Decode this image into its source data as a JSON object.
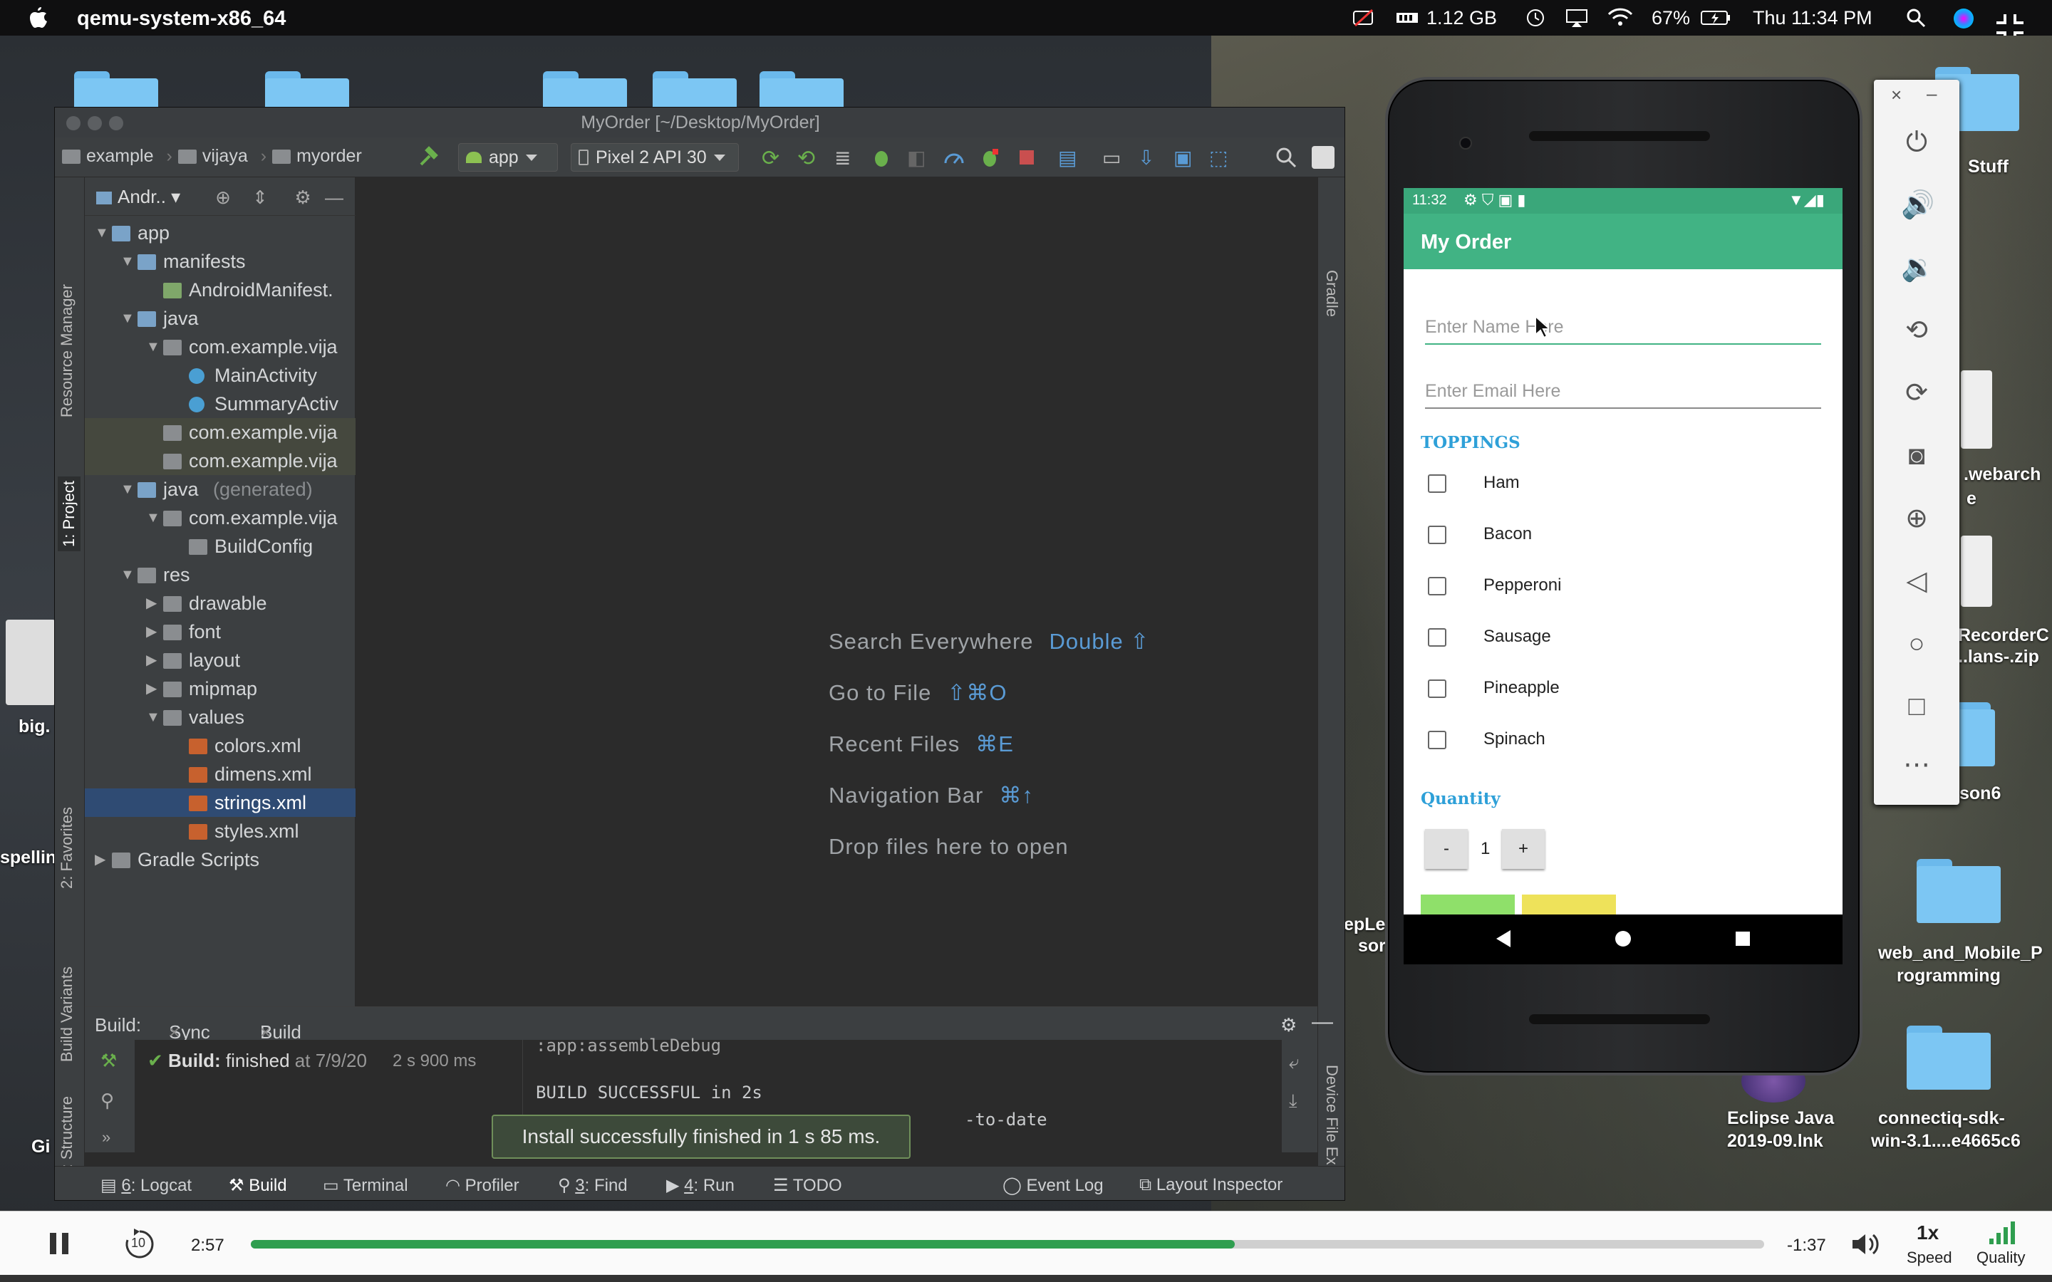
{
  "menubar": {
    "app_name": "qemu-system-x86_64",
    "memory": "1.12 GB",
    "battery": "67%",
    "clock": "Thu 11:34 PM"
  },
  "desktop": {
    "items": [
      {
        "label": "Stuff"
      },
      {
        "label": ".webarch"
      },
      {
        "label": "e"
      },
      {
        "label": "RecorderC"
      },
      {
        "label": "..lans-.zip"
      },
      {
        "label": "son6"
      },
      {
        "label": "web_and_Mobile_P"
      },
      {
        "label": "rogramming"
      },
      {
        "label": "Eclipse Java"
      },
      {
        "label": "2019-09.lnk"
      },
      {
        "label": "connectiq-sdk-"
      },
      {
        "label": "win-3.1....e4665c6"
      },
      {
        "label": "big."
      },
      {
        "label": "spellin"
      },
      {
        "label": "Gi"
      },
      {
        "label": "epLe"
      },
      {
        "label": "sor"
      }
    ]
  },
  "studio": {
    "title": "MyOrder [~/Desktop/MyOrder]",
    "breadcrumbs": [
      "example",
      "vijaya",
      "myorder"
    ],
    "run_config": "app",
    "device": "Pixel 2 API 30",
    "left_tabs": [
      "Resource Manager",
      "1: Project",
      "2: Favorites",
      "Build Variants",
      "Z: Structure"
    ],
    "right_tabs": [
      "Gradle",
      "Device File Explorer"
    ],
    "project_view": "Andr..",
    "tree": [
      {
        "label": "app"
      },
      {
        "label": "manifests"
      },
      {
        "label": "AndroidManifest."
      },
      {
        "label": "java"
      },
      {
        "label": "com.example.vija"
      },
      {
        "label": "MainActivity"
      },
      {
        "label": "SummaryActiv"
      },
      {
        "label": "com.example.vija"
      },
      {
        "label": "com.example.vija"
      },
      {
        "label": "java",
        "extra": "(generated)"
      },
      {
        "label": "com.example.vija"
      },
      {
        "label": "BuildConfig"
      },
      {
        "label": "res"
      },
      {
        "label": "drawable"
      },
      {
        "label": "font"
      },
      {
        "label": "layout"
      },
      {
        "label": "mipmap"
      },
      {
        "label": "values"
      },
      {
        "label": "colors.xml"
      },
      {
        "label": "dimens.xml"
      },
      {
        "label": "strings.xml"
      },
      {
        "label": "styles.xml"
      },
      {
        "label": "Gradle Scripts"
      }
    ],
    "hints": [
      {
        "label": "Search Everywhere",
        "key": "Double ⇧"
      },
      {
        "label": "Go to File",
        "key": "⇧⌘O"
      },
      {
        "label": "Recent Files",
        "key": "⌘E"
      },
      {
        "label": "Navigation Bar",
        "key": "⌘↑"
      },
      {
        "label": "Drop files here to open",
        "key": ""
      }
    ],
    "build": {
      "label": "Build:",
      "tabs": [
        "Sync",
        "Build Output"
      ],
      "status_bold": "Build:",
      "status": "finished",
      "status_time": "at 7/9/20",
      "duration": "2 s 900 ms",
      "output_lines": [
        ":app:assembleDebug",
        "BUILD SUCCESSFUL in 2s",
        "-to-date"
      ]
    },
    "toast": "Install successfully finished in 1 s 85 ms.",
    "bottom_tabs": [
      {
        "num": "6",
        "label": ": Logcat"
      },
      {
        "num": "",
        "label": "Build"
      },
      {
        "num": "",
        "label": "Terminal"
      },
      {
        "num": "",
        "label": "Profiler"
      },
      {
        "num": "3",
        "label": ": Find"
      },
      {
        "num": "4",
        "label": ": Run"
      },
      {
        "num": "",
        "label": "TODO"
      },
      {
        "num": "",
        "label": "Event Log"
      },
      {
        "num": "",
        "label": "Layout Inspector"
      }
    ]
  },
  "phone": {
    "time": "11:32",
    "app_title": "My Order",
    "name_placeholder": "Enter Name Here",
    "email_placeholder": "Enter Email Here",
    "toppings_title": "TOPPINGS",
    "toppings": [
      "Ham",
      "Bacon",
      "Pepperoni",
      "Sausage",
      "Pineapple",
      "Spinach"
    ],
    "quantity_title": "Quantity",
    "minus": "-",
    "quantity": "1",
    "plus": "+",
    "colors": {
      "appbar": "#41b384",
      "accent": "#2ea0d8"
    }
  },
  "video": {
    "elapsed": "2:57",
    "remaining": "-1:37",
    "speed_value": "1x",
    "speed_label": "Speed",
    "quality_label": "Quality",
    "progress": 0.65,
    "skip_back": "10",
    "progress_color": "#2f9e4f"
  }
}
